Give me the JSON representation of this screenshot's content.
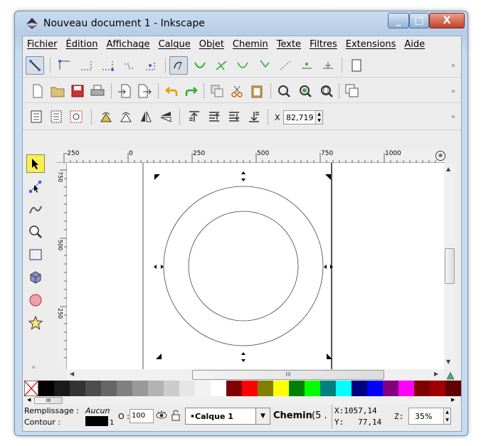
{
  "window": {
    "title": "Nouveau document 1 - Inkscape",
    "min_label": "_",
    "max_label": "□",
    "close_label": "X"
  },
  "menu": [
    "Fichier",
    "Édition",
    "Affichage",
    "Calque",
    "Objet",
    "Chemin",
    "Texte",
    "Filtres",
    "Extensions",
    "Aide"
  ],
  "toolbar": {
    "x_label": "X",
    "x_value": "82,719"
  },
  "rulers": {
    "h_ticks": [
      "-250",
      "0",
      "250",
      "500",
      "750",
      "1000"
    ],
    "v_ticks": [
      "750",
      "500",
      "250"
    ]
  },
  "hscroll_label": "III",
  "palette": [
    "#000000",
    "#1a1a1a",
    "#333333",
    "#4d4d4d",
    "#666666",
    "#808080",
    "#999999",
    "#b3b3b3",
    "#cccccc",
    "#e6e6e6",
    "#f2f2f2",
    "#ffffff",
    "#800000",
    "#ff0000",
    "#808000",
    "#ffff00",
    "#008000",
    "#00ff00",
    "#008080",
    "#00ffff",
    "#000080",
    "#0000ff",
    "#800080",
    "#ff00ff",
    "#800000",
    "#a00000",
    "#600000"
  ],
  "palette_scroll_label": "III",
  "status": {
    "fill_label": "Remplissage :",
    "fill_value": "Aucun",
    "stroke_label": "Contour :",
    "stroke_width": "1",
    "opacity_label": "O :",
    "opacity_value": "100",
    "layer": "•Calque 1",
    "selection": "Chemin",
    "selection_extra": "(5 .",
    "x_coord": "X:1057,14",
    "y_coord": "Y:   77,14",
    "zoom_label": "Z:",
    "zoom_value": "35%"
  }
}
